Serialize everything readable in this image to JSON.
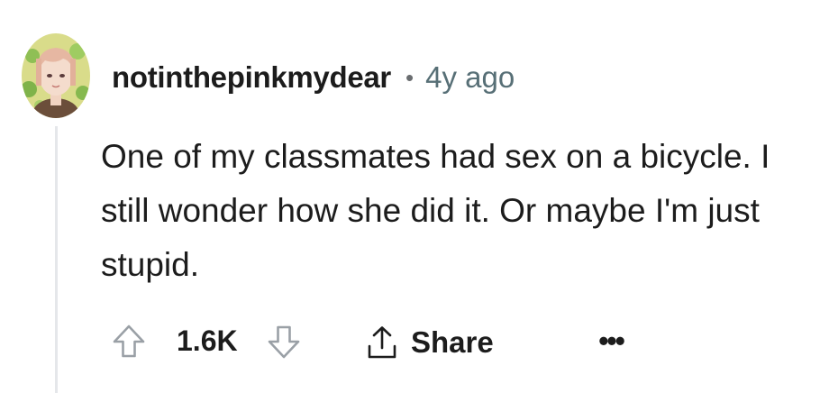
{
  "comment": {
    "username": "notinthepinkmydear",
    "separator": "•",
    "time_ago": "4y ago",
    "body": "One of my classmates had sex on a bicycle. I still wonder how she did it. Or maybe I'm just stupid.",
    "score": "1.6K",
    "share_label": "Share",
    "more_label": "•••"
  },
  "icons": {
    "upvote": "arrow-up-icon",
    "downvote": "arrow-down-icon",
    "share": "share-upload-icon",
    "more": "ellipsis-icon"
  },
  "colors": {
    "text": "#1c1c1c",
    "meta": "#576f76",
    "icon": "#9aa0a6",
    "thread_line": "#e5e7ea"
  }
}
